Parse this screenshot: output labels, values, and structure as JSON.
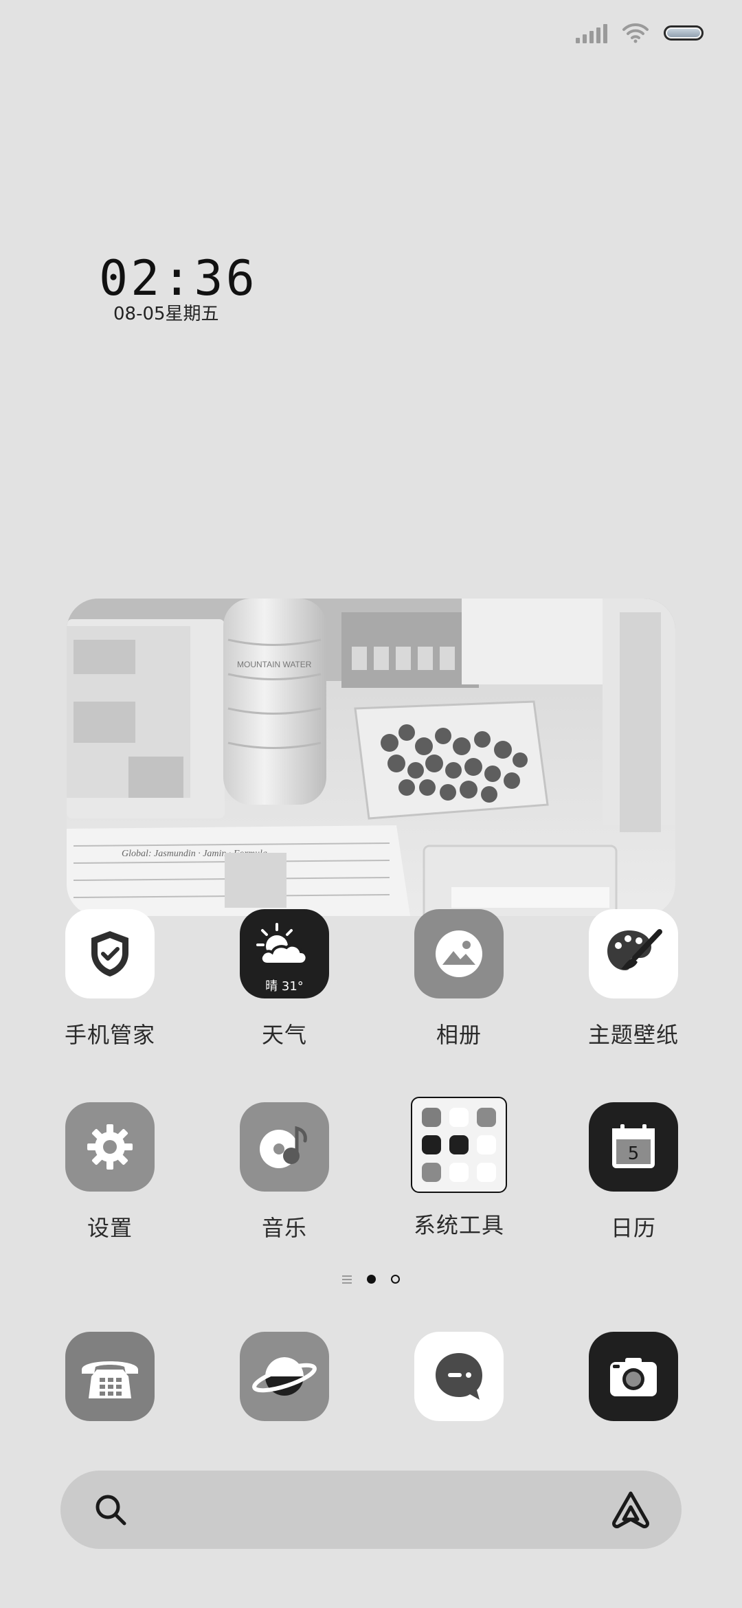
{
  "status_bar": {
    "icons": [
      "signal-icon",
      "wifi-icon",
      "battery-icon"
    ]
  },
  "clock": {
    "time": "02:36",
    "date": "08-05星期五"
  },
  "photo_widget": {
    "handwriting_line_1": "Global: Jasmundin · Jamin · Formula",
    "bottle_label": "MOUNTAIN WATER"
  },
  "apps_row1": [
    {
      "label": "手机管家",
      "icon": "shield-check-icon"
    },
    {
      "label": "天气",
      "icon": "weather-sun-cloud-icon",
      "badge": "晴 31°"
    },
    {
      "label": "相册",
      "icon": "gallery-mountain-icon"
    },
    {
      "label": "主题壁纸",
      "icon": "palette-brush-icon"
    }
  ],
  "apps_row2": [
    {
      "label": "设置",
      "icon": "gear-icon"
    },
    {
      "label": "音乐",
      "icon": "music-disc-icon"
    },
    {
      "label": "系统工具",
      "icon": "folder-icon"
    },
    {
      "label": "日历",
      "icon": "calendar-icon",
      "badge": "5"
    }
  ],
  "dock": [
    {
      "name": "phone",
      "icon": "phone-icon"
    },
    {
      "name": "browser",
      "icon": "planet-icon"
    },
    {
      "name": "messages",
      "icon": "message-bubble-icon"
    },
    {
      "name": "camera",
      "icon": "camera-icon"
    }
  ],
  "page_indicator": {
    "pages": 2,
    "current": 1
  },
  "search": {
    "icons": [
      "search-icon",
      "assistant-icon"
    ]
  },
  "colors": {
    "background": "#e2e2e2",
    "dark_icon": "#1f1f1f",
    "gray_icon": "#8c8c8c",
    "white_icon": "#ffffff",
    "search_bar": "#cbcbcb"
  }
}
